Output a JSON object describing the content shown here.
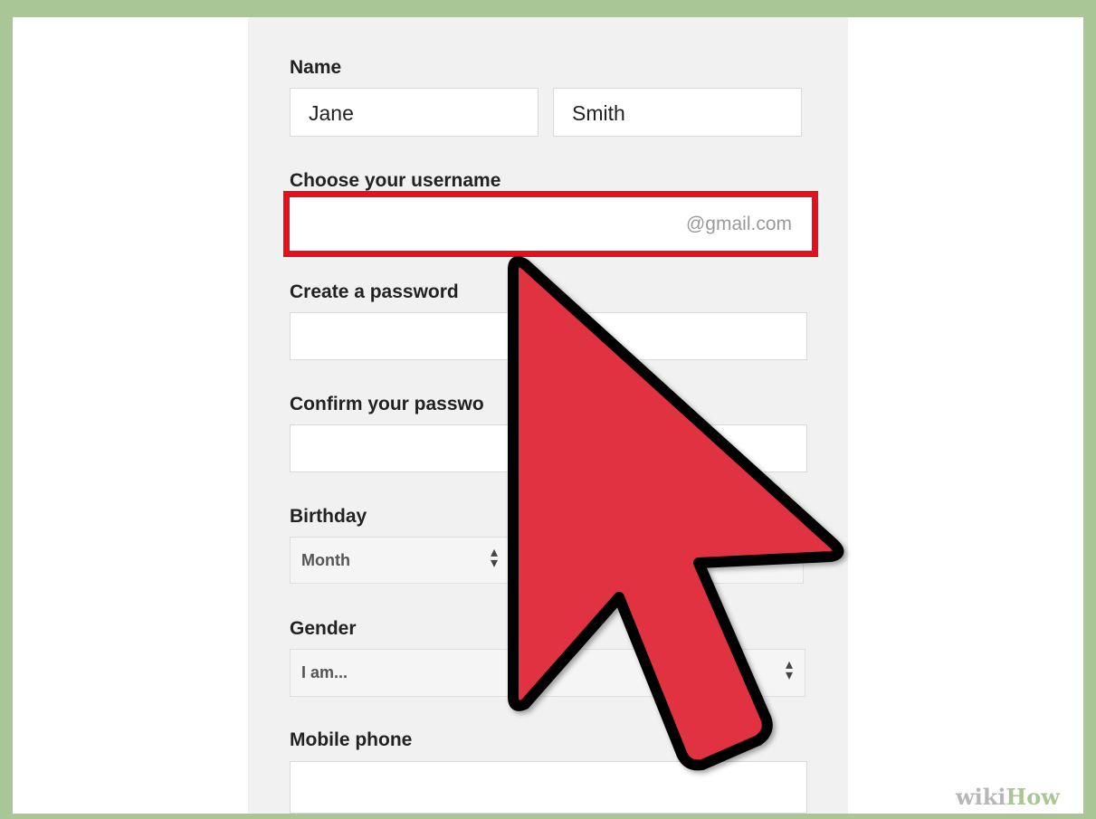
{
  "form": {
    "name_label": "Name",
    "first_name_value": "Jane",
    "last_name_value": "Smith",
    "username_label": "Choose your username",
    "username_value": "",
    "username_suffix": "@gmail.com",
    "password_label": "Create a password",
    "password_value": "",
    "confirm_label": "Confirm your passwo",
    "confirm_value": "",
    "birthday_label": "Birthday",
    "birthday_month_selected": "Month",
    "gender_label": "Gender",
    "gender_selected": "I am...",
    "mobile_label": "Mobile phone",
    "mobile_value": ""
  },
  "watermark": {
    "part1": "wiki",
    "part2": "How"
  },
  "colors": {
    "highlight_border": "#e3101e",
    "arrow_fill": "#e0313f",
    "frame": "#a9c696"
  },
  "icons": {
    "cursor": "arrow-cursor-icon",
    "select_arrows": "up-down-arrows-icon"
  }
}
